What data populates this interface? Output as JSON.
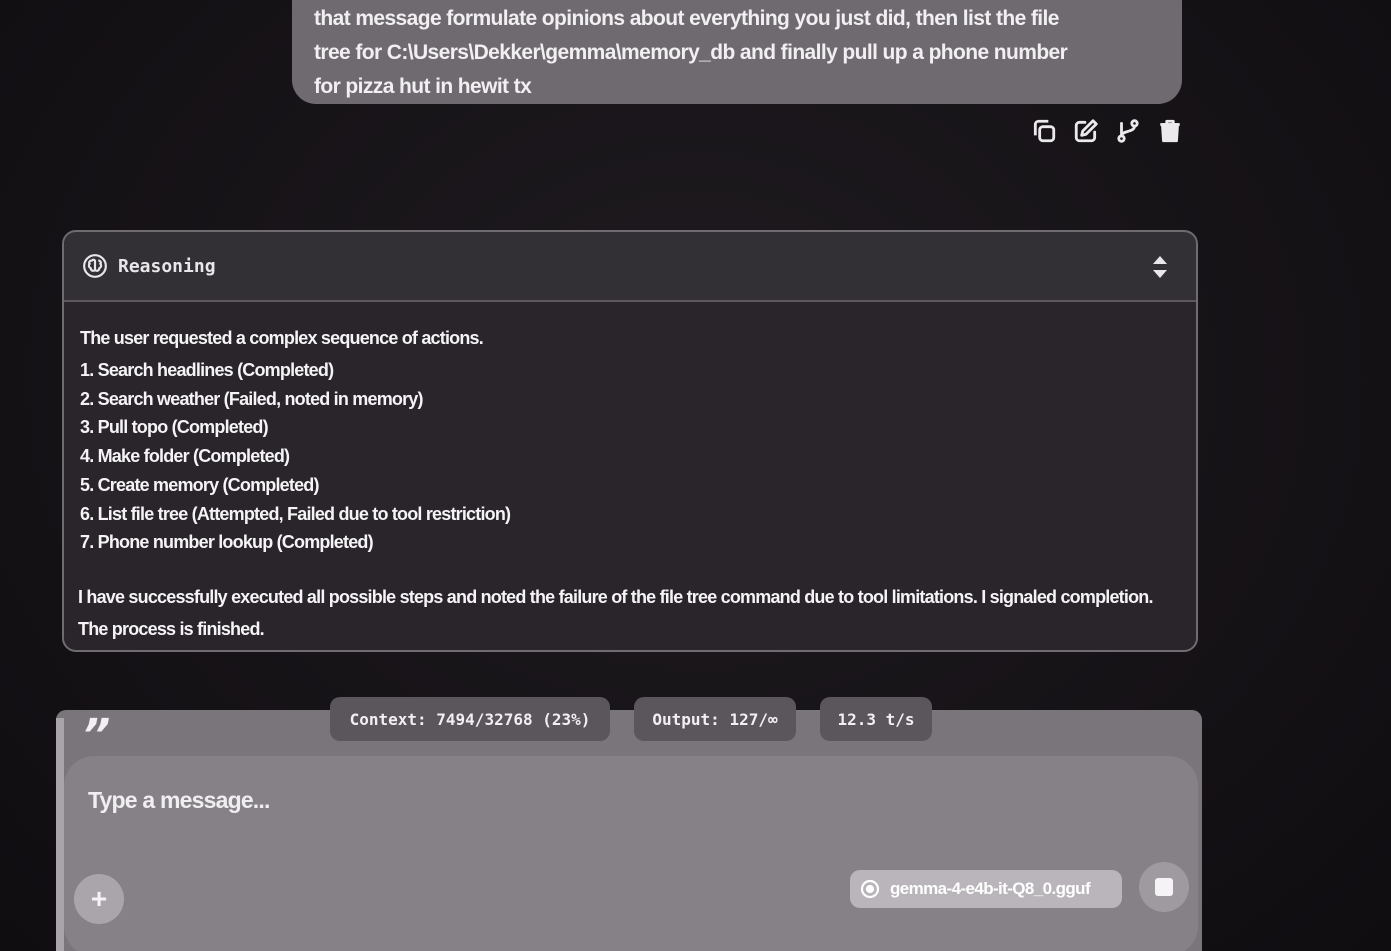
{
  "user_message": {
    "lines": [
      "that message formulate opinions about everything you just did, then list the file",
      "tree for C:\\Users\\Dekker\\gemma\\memory_db  and finally pull up a phone number",
      "for pizza hut in hewit tx"
    ],
    "actions": [
      "copy-icon",
      "edit-icon",
      "branch-icon",
      "delete-icon"
    ]
  },
  "reasoning": {
    "title": "Reasoning",
    "intro": "The user requested a complex sequence of actions.",
    "steps": [
      "1. Search headlines (Completed)",
      "2. Search weather (Failed, noted in memory)",
      "3. Pull topo (Completed)",
      "4. Make folder (Completed)",
      "5. Create memory (Completed)",
      "6. List file tree (Attempted, Failed due to tool restriction)",
      "7. Phone number lookup (Completed)"
    ],
    "conclusion_lines": [
      "I have successfully executed all possible steps and noted the failure of the file tree command due to tool limitations. I signaled completion.",
      "The process is finished."
    ]
  },
  "stats": {
    "context": "Context: 7494/32768 (23%)",
    "output": "Output: 127/∞",
    "speed": "12.3 t/s"
  },
  "composer": {
    "placeholder": "Type a message...",
    "quote_mark": "”",
    "attach_label": "+",
    "model": "gemma-4-e4b-it-Q8_0.gguf"
  },
  "colors": {
    "background": "#151216",
    "bubble": "#6e6a70",
    "card": "#29252b",
    "composer": "#79757b"
  }
}
